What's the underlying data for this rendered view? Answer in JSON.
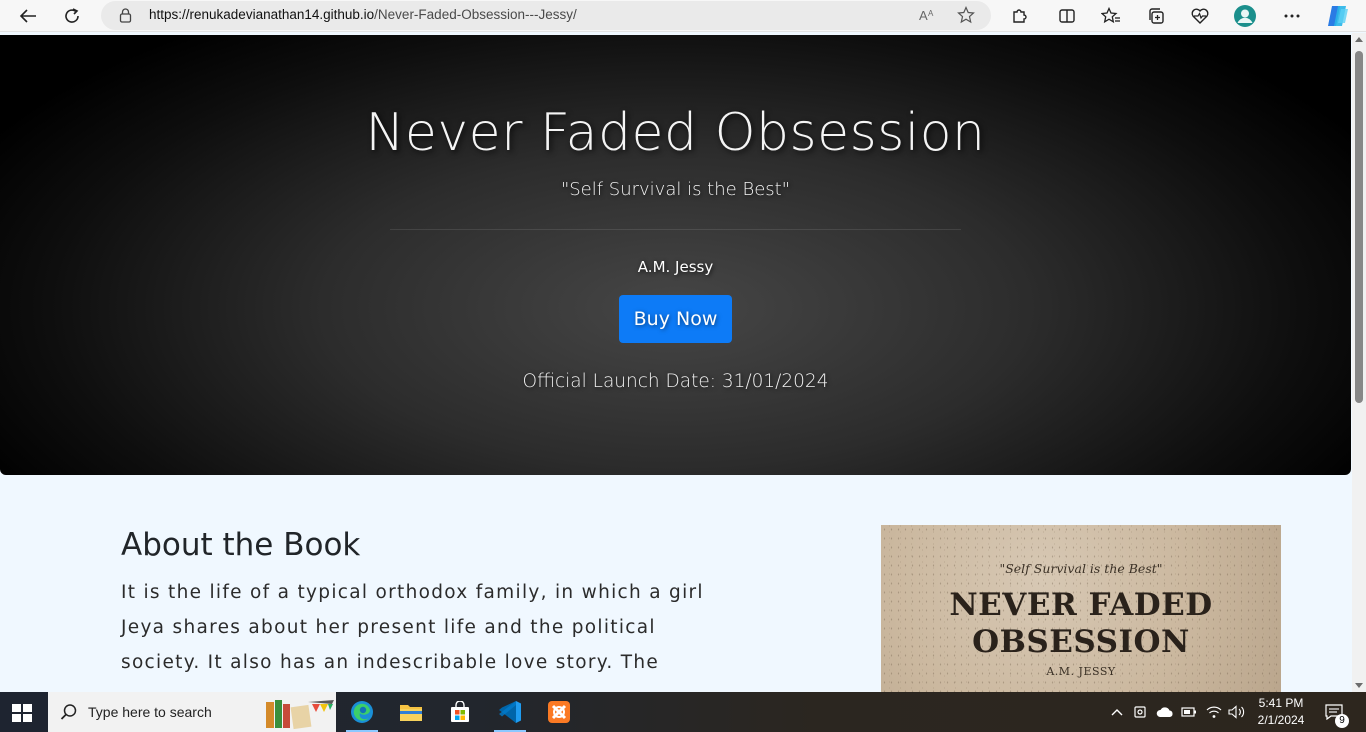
{
  "browser": {
    "url_host": "https://renukadevianathan14.github.io",
    "url_path": "/Never-Faded-Obsession---Jessy/"
  },
  "hero": {
    "title": "Never Faded Obsession",
    "tagline": "\"Self Survival is the Best\"",
    "author": "A.M. Jessy",
    "buy_label": "Buy Now",
    "launch": "Official Launch Date: 31/01/2024",
    "button_color": "#0d7bf7"
  },
  "about": {
    "title": "About the Book",
    "lines": [
      "It is the life of a typical orthodox family, in which a girl",
      "Jeya shares about her present life and the political",
      "society. It also has an indescribable love story. The"
    ]
  },
  "cover": {
    "tagline": "\"Self Survival is the Best\"",
    "title_line1": "NEVER FADED",
    "title_line2": "OBSESSION",
    "author": "A.M. JESSY"
  },
  "taskbar": {
    "search_placeholder": "Type here to search",
    "time": "5:41 PM",
    "date": "2/1/2024",
    "notification_count": "9"
  },
  "icons": [
    "back-icon",
    "refresh-icon",
    "lock-icon",
    "read-aloud-icon",
    "favorite-star-icon",
    "extensions-icon",
    "split-screen-icon",
    "favorites-icon",
    "collections-icon",
    "performance-icon",
    "profile-icon",
    "more-icon",
    "copilot-icon",
    "windows-start-icon",
    "search-icon",
    "edge-icon",
    "file-explorer-icon",
    "store-icon",
    "vscode-icon",
    "xampp-icon"
  ]
}
